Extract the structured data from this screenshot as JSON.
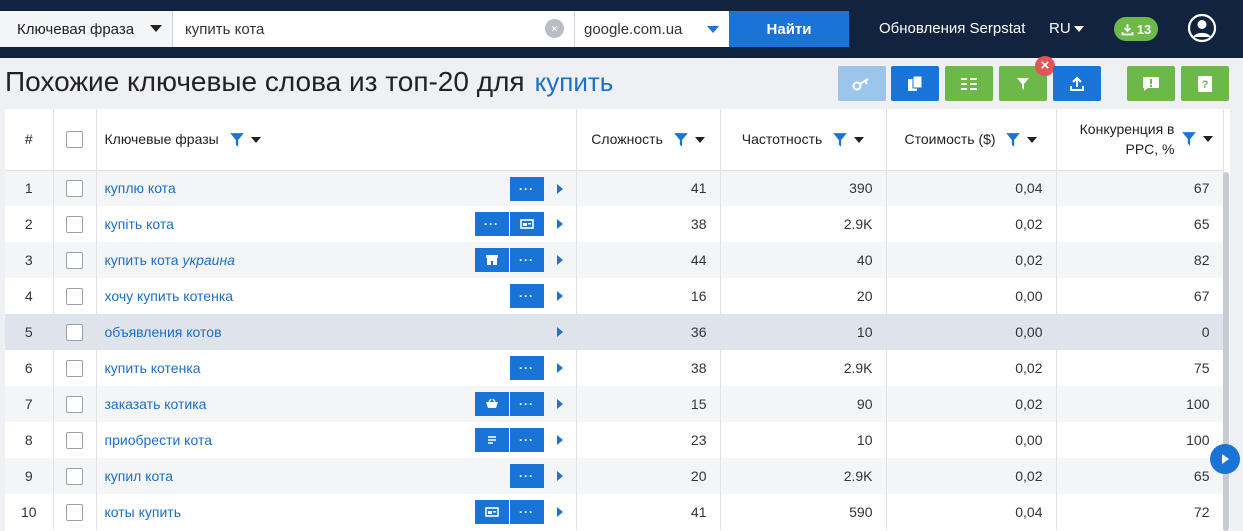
{
  "search": {
    "type_label": "Ключевая фраза",
    "query_value": "купить кота",
    "database": "google.com.ua",
    "find_label": "Найти"
  },
  "header": {
    "updates_label": "Обновления Serpstat",
    "language": "RU",
    "downloads_count": "13"
  },
  "page": {
    "title": "Похожие ключевые слова из топ-20 для",
    "keyword": "купить"
  },
  "table": {
    "columns": {
      "index": "#",
      "keyword": "Ключевые фразы",
      "difficulty": "Сложность",
      "volume": "Частотность",
      "cost": "Стоимость ($)",
      "competition": "Конкуренция в PPC, %"
    },
    "rows": [
      {
        "n": "1",
        "kw": "куплю кота",
        "kw_em": "",
        "difficulty": "41",
        "volume": "390",
        "cost": "0,04",
        "competition": "67",
        "actions": [
          "more"
        ]
      },
      {
        "n": "2",
        "kw": "купіть кота",
        "kw_em": "",
        "difficulty": "38",
        "volume": "2.9K",
        "cost": "0,02",
        "competition": "65",
        "actions": [
          "more",
          "ad"
        ]
      },
      {
        "n": "3",
        "kw": "купить кота",
        "kw_em": "украина",
        "difficulty": "44",
        "volume": "40",
        "cost": "0,02",
        "competition": "82",
        "actions": [
          "shop",
          "more"
        ]
      },
      {
        "n": "4",
        "kw": "хочу купить котенка",
        "kw_em": "",
        "difficulty": "16",
        "volume": "20",
        "cost": "0,00",
        "competition": "67",
        "actions": [
          "more"
        ]
      },
      {
        "n": "5",
        "kw": "объявления котов",
        "kw_em": "",
        "difficulty": "36",
        "volume": "10",
        "cost": "0,00",
        "competition": "0",
        "actions": []
      },
      {
        "n": "6",
        "kw": "купить котенка",
        "kw_em": "",
        "difficulty": "38",
        "volume": "2.9K",
        "cost": "0,02",
        "competition": "75",
        "actions": [
          "more"
        ]
      },
      {
        "n": "7",
        "kw": "заказать котика",
        "kw_em": "",
        "difficulty": "15",
        "volume": "90",
        "cost": "0,02",
        "competition": "100",
        "actions": [
          "cart",
          "more"
        ]
      },
      {
        "n": "8",
        "kw": "приобрести кота",
        "kw_em": "",
        "difficulty": "23",
        "volume": "10",
        "cost": "0,00",
        "competition": "100",
        "actions": [
          "list",
          "more"
        ]
      },
      {
        "n": "9",
        "kw": "купил кота",
        "kw_em": "",
        "difficulty": "20",
        "volume": "2.9K",
        "cost": "0,02",
        "competition": "65",
        "actions": [
          "more"
        ]
      },
      {
        "n": "10",
        "kw": "коты купить",
        "kw_em": "",
        "difficulty": "41",
        "volume": "590",
        "cost": "0,04",
        "competition": "72",
        "actions": [
          "ad",
          "more"
        ]
      }
    ]
  },
  "colors": {
    "topbar": "#12233f",
    "accent_blue": "#1a73d6",
    "accent_green": "#6cb94a",
    "link": "#1a6fc9"
  }
}
